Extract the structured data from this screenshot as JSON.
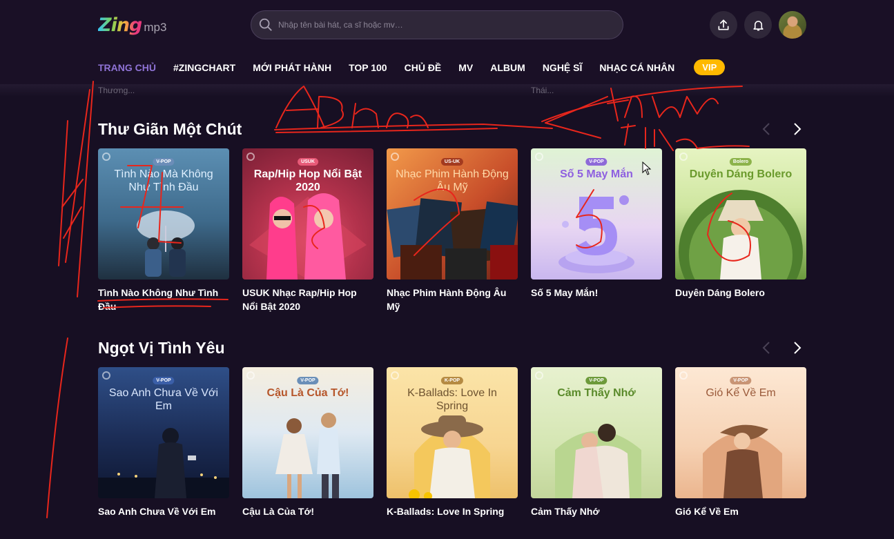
{
  "header": {
    "logo_brand": "Zing",
    "logo_suffix": "mp3",
    "search_placeholder": "Nhập tên bài hát, ca sĩ hoặc mv…"
  },
  "nav": {
    "items": [
      "TRANG CHỦ",
      "#ZINGCHART",
      "MỚI PHÁT HÀNH",
      "TOP 100",
      "CHỦ ĐỀ",
      "MV",
      "ALBUM",
      "NGHỆ SĨ",
      "NHẠC CÁ NHÂN"
    ],
    "vip": "VIP",
    "active_index": 0
  },
  "peek": {
    "left": "Thương...",
    "right": "Thái..."
  },
  "sections": [
    {
      "title": "Thư Giãn Một Chút",
      "cards": [
        {
          "title": "Tình Nào Không Như Tình Đầu",
          "thumb_tag": "V-POP",
          "thumb_title": "Tình Nào Mà Không Như Tình Đầu"
        },
        {
          "title": "USUK Nhạc Rap/Hip Hop Nổi Bật 2020",
          "thumb_tag": "USUK",
          "thumb_title": "Rap/Hip Hop Nổi Bật 2020"
        },
        {
          "title": "Nhạc Phim Hành Động Âu Mỹ",
          "thumb_tag": "US-UK",
          "thumb_title": "Nhạc Phim Hành Động Âu Mỹ"
        },
        {
          "title": "Số 5 May Mắn!",
          "thumb_tag": "V-POP",
          "thumb_title": "Số 5 May Mắn"
        },
        {
          "title": "Duyên Dáng Bolero",
          "thumb_tag": "Bolero",
          "thumb_title": "Duyên Dáng Bolero"
        }
      ]
    },
    {
      "title": "Ngọt Vị Tình Yêu",
      "cards": [
        {
          "title": "Sao Anh Chưa Về Với Em",
          "thumb_tag": "V-POP",
          "thumb_title": "Sao Anh Chưa Về Với Em"
        },
        {
          "title": "Cậu Là Của Tớ!",
          "thumb_tag": "V-POP",
          "thumb_title": "Cậu Là Của Tớ!"
        },
        {
          "title": "K-Ballads: Love In Spring",
          "thumb_tag": "K-POP",
          "thumb_title": "K-Ballads: Love In Spring"
        },
        {
          "title": "Cảm Thấy Nhớ",
          "thumb_tag": "V-POP",
          "thumb_title": "Cảm Thấy Nhớ"
        },
        {
          "title": "Gió Kể Về Em",
          "thumb_tag": "V-POP",
          "thumb_title": "Gió Kể Về Em"
        }
      ]
    }
  ],
  "colors": {
    "background": "#170f23",
    "accent": "#8f73d6",
    "vip": "#ffb900",
    "annotation": "#e8261c"
  },
  "icons": [
    "search-icon",
    "upload-icon",
    "bell-icon",
    "chevron-left-icon",
    "chevron-right-icon",
    "globe-icon"
  ]
}
